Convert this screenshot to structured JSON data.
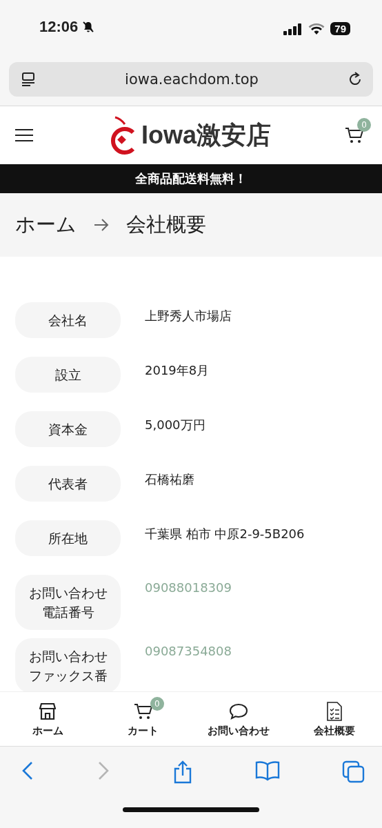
{
  "status_bar": {
    "time": "12:06",
    "battery": "79"
  },
  "address_bar": {
    "url": "iowa.eachdom.top"
  },
  "header": {
    "logo": "Iowa激安店",
    "cart_count": "0"
  },
  "banner": "全商品配送料無料！",
  "breadcrumb": [
    "ホーム",
    "会社概要"
  ],
  "company_info": [
    {
      "label": "会社名",
      "value": "上野秀人市場店",
      "kind": "text"
    },
    {
      "label": "設立",
      "value": "2019年8月",
      "kind": "text"
    },
    {
      "label": "資本金",
      "value": "5,000万円",
      "kind": "text"
    },
    {
      "label": "代表者",
      "value": "石橋祐磨",
      "kind": "text"
    },
    {
      "label": "所在地",
      "value": "千葉県 柏市 中原2-9-5B206",
      "kind": "text"
    },
    {
      "label": "お問い合わせ電話番号",
      "value": "09088018309",
      "kind": "link"
    },
    {
      "label": "お問い合わせファックス番",
      "value": "09087354808",
      "kind": "link"
    }
  ],
  "bottom_nav": [
    {
      "label": "ホーム",
      "kind": "home"
    },
    {
      "label": "カート",
      "kind": "cart",
      "badge": "0"
    },
    {
      "label": "お問い合わせ",
      "kind": "chat"
    },
    {
      "label": "会社概要",
      "kind": "document"
    }
  ],
  "browser_toolbar": [
    {
      "kind": "back",
      "disabled": false
    },
    {
      "kind": "forward",
      "disabled": true
    },
    {
      "kind": "share",
      "disabled": false
    },
    {
      "kind": "bookmarks",
      "disabled": false
    },
    {
      "kind": "tabs",
      "disabled": false
    }
  ]
}
